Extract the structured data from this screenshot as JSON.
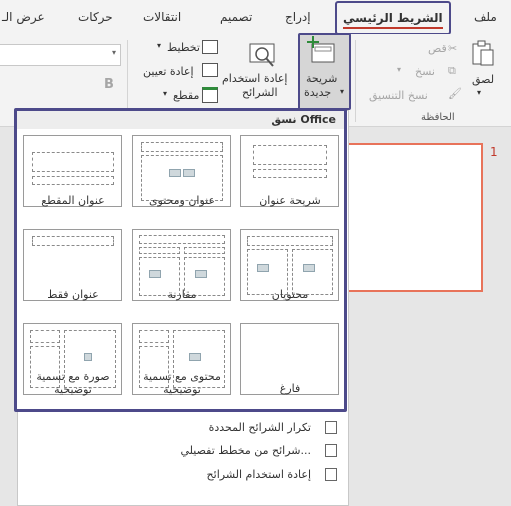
{
  "tabs": [
    "ملف",
    "الشريط الرئيسي",
    "إدراج",
    "تصميم",
    "انتقالات",
    "حركات",
    "عرض الـ"
  ],
  "clipboard": {
    "paste": "لصق",
    "cut": "قص",
    "copy": "نسخ",
    "format_painter": "نسخ التنسيق",
    "group_label": "الحافظة"
  },
  "slides_group": {
    "new_slide_line1": "شريحة",
    "new_slide_line2": "جديدة",
    "reuse_line1": "إعادة استخدام",
    "reuse_line2": "الشرائح",
    "layout": "تخطيط",
    "reset": "إعادة تعيين",
    "section": "مقطع"
  },
  "font_group": {
    "bold": "B"
  },
  "slide_number": "1",
  "gallery": {
    "title": "نسق Office",
    "layouts": [
      {
        "label": "شريحة عنوان"
      },
      {
        "label": "عنوان ومحتوى"
      },
      {
        "label": "عنوان المقطع"
      },
      {
        "label": "محتويان"
      },
      {
        "label": "مقارنة"
      },
      {
        "label": "عنوان فقط"
      },
      {
        "label": "فارغ"
      },
      {
        "label": "محتوى مع تسمية توضيحية"
      },
      {
        "label": "صورة مع تسمية توضيحية"
      }
    ]
  },
  "menu": [
    "تكرار الشرائح المحددة",
    "شرائح من مخطط تفصيلي...",
    "إعادة استخدام الشرائح"
  ],
  "colors": {
    "highlight": "#4d4a8a",
    "accent_red": "#c0392b",
    "thumb_border": "#e8735a"
  }
}
